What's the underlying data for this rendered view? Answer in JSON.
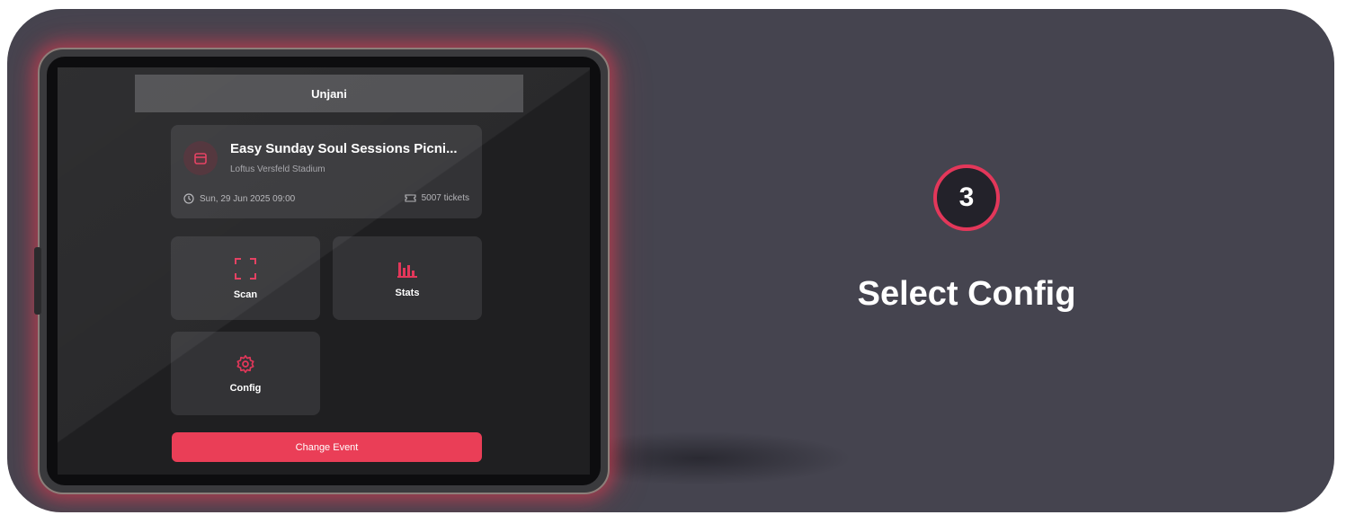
{
  "app": {
    "title": "Unjani"
  },
  "event": {
    "title": "Easy Sunday Soul Sessions Picni...",
    "venue": "Loftus Versfeld Stadium",
    "datetime": "Sun, 29 Jun 2025 09:00",
    "tickets": "5007 tickets",
    "icons": {
      "calendar": "calendar-icon",
      "clock": "clock-icon",
      "ticket": "ticket-icon"
    }
  },
  "tiles": {
    "scan": {
      "label": "Scan",
      "icon": "scan-frame-icon"
    },
    "stats": {
      "label": "Stats",
      "icon": "bar-chart-icon"
    },
    "config": {
      "label": "Config",
      "icon": "gear-icon"
    }
  },
  "actions": {
    "change_event": "Change Event"
  },
  "step": {
    "number": "3",
    "title": "Select Config"
  },
  "colors": {
    "accent": "#ea3e57",
    "banner_bg": "#45444f",
    "screen_bg": "#1f1f21",
    "card_bg": "#333336"
  }
}
